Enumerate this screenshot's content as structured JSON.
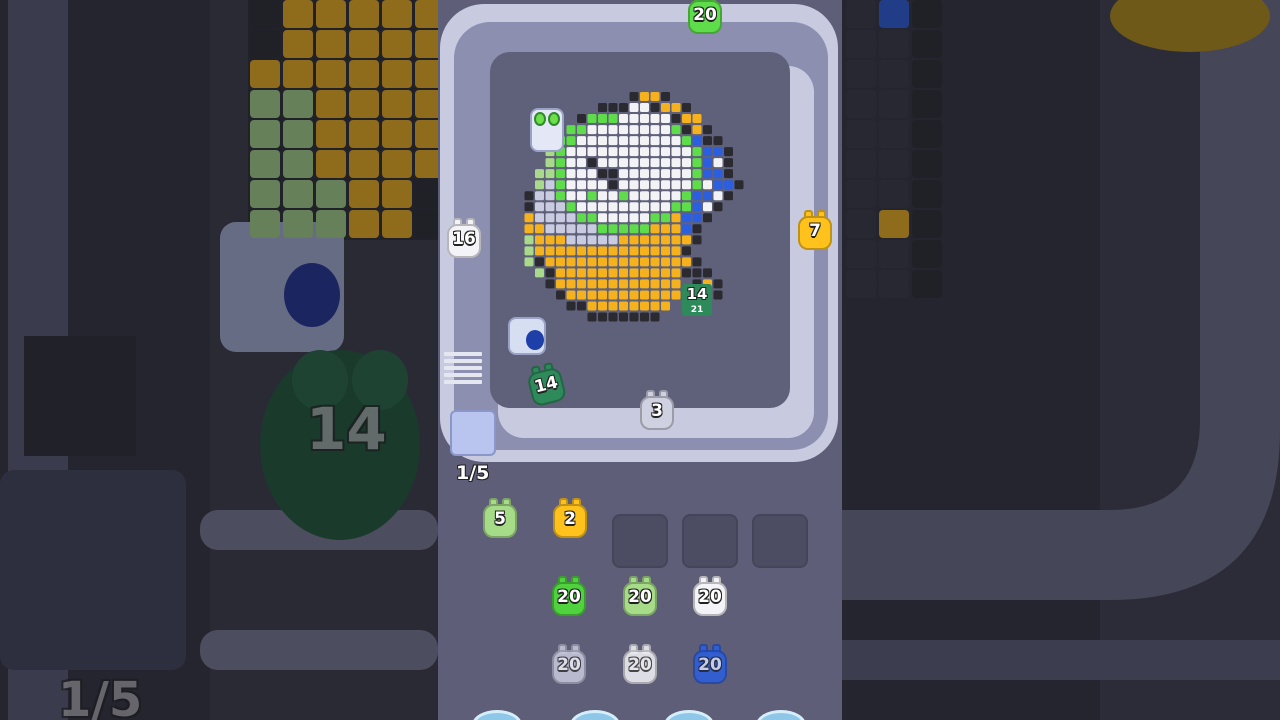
{
  "colors": {
    "track": "#c8cbe0",
    "lane": "#8d8fb0",
    "board": "#5f6079",
    "panel": "#5e5e78"
  },
  "progress": {
    "label": "1/5",
    "current": 1,
    "total": 5
  },
  "conveyor_pigs": [
    {
      "id": "top",
      "value": "20",
      "color": "#5fdc4a"
    },
    {
      "id": "left",
      "value": "16",
      "color": "#f4f4f8"
    },
    {
      "id": "right",
      "value": "7",
      "color": "#ffc21c"
    },
    {
      "id": "bottom-left",
      "value": "14",
      "color": "#2e8a5a"
    },
    {
      "id": "bottom",
      "value": "3",
      "color": "#cfd0e0"
    }
  ],
  "board_label": {
    "value": "14",
    "sub": "21"
  },
  "queue_slots": [
    {
      "value": "5",
      "color": "#a6dc87"
    },
    {
      "value": "2",
      "color": "#ffc21c"
    },
    {
      "value": "",
      "color": ""
    },
    {
      "value": "",
      "color": ""
    },
    {
      "value": "",
      "color": ""
    }
  ],
  "queue_columns": [
    [
      {
        "value": "20",
        "color": "#4fd23d"
      },
      {
        "value": "20",
        "color": "#c9cbe0",
        "faded": true
      }
    ],
    [
      {
        "value": "20",
        "color": "#a6dc87"
      },
      {
        "value": "20",
        "color": "#f4f4f8",
        "faded": true
      }
    ],
    [
      {
        "value": "20",
        "color": "#f4f4f8"
      },
      {
        "value": "20",
        "color": "#2c5fe0",
        "faded": true
      }
    ]
  ],
  "background": {
    "big_number": "14",
    "progress_label": "1/5"
  }
}
